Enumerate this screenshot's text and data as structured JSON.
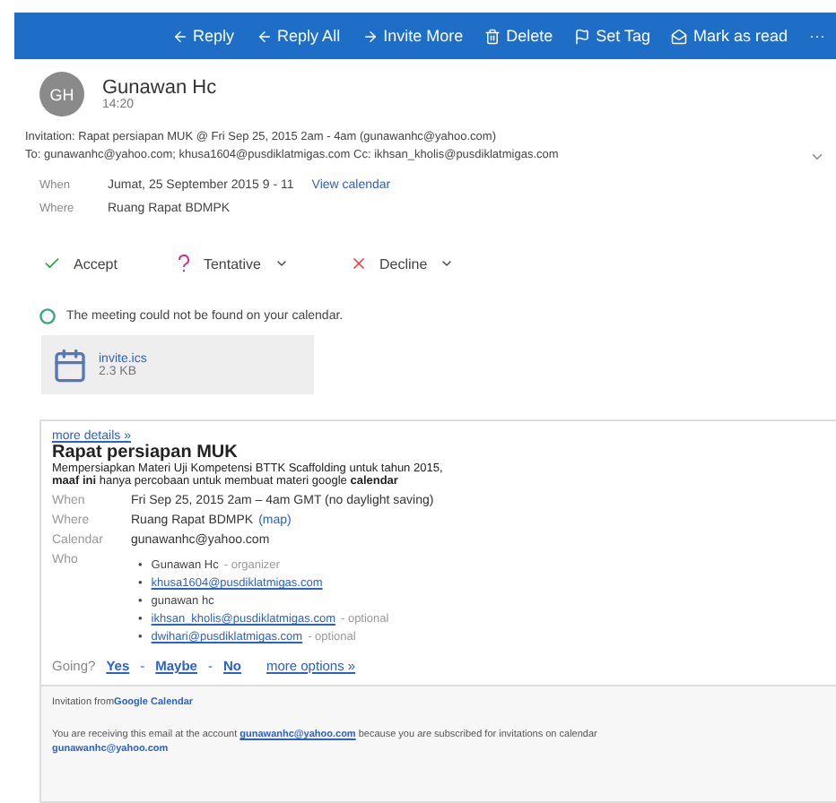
{
  "toolbar": {
    "actions": [
      {
        "kind": "reply",
        "label": "Reply"
      },
      {
        "kind": "reply-all",
        "label": "Reply All"
      },
      {
        "kind": "invite",
        "label": "Invite More"
      },
      {
        "kind": "delete",
        "label": "Delete"
      },
      {
        "kind": "flag",
        "label": "Set Tag"
      },
      {
        "kind": "read",
        "label": "Mark as read"
      }
    ],
    "more": "···"
  },
  "sender": {
    "initials": "GH",
    "name": "Gunawan Hc",
    "time": "14:20"
  },
  "subject": "Invitation: Rapat persiapan MUK @ Fri Sep 25, 2015 2am - 4am (gunawanhc@yahoo.com)",
  "recipients": "To: gunawanhc@yahoo.com; khusa1604@pusdiklatmigas.com  Cc: ikhsan_kholis@pusdiklatmigas.com",
  "meeting": {
    "when_label": "When",
    "when": "Jumat, 25 September 2015 9 - 11",
    "view_calendar": "View calendar",
    "where_label": "Where",
    "where": "Ruang Rapat BDMPK"
  },
  "responses": [
    {
      "kind": "accept",
      "label": "Accept",
      "dropdown": false
    },
    {
      "kind": "tentative",
      "label": "Tentative",
      "dropdown": true
    },
    {
      "kind": "decline",
      "label": "Decline",
      "dropdown": true
    }
  ],
  "status": "The meeting could not be found on your calendar.",
  "attachment": {
    "name": "invite.ics",
    "size": "2.3 KB"
  },
  "body": {
    "more_details": "more details »",
    "title": "Rapat persiapan MUK",
    "description": [
      "Mempersiapkan Materi Uji Kompetensi BTTK Scaffolding untuk tahun 2015,",
      "**maaf ini** hanya percobaan untuk membuat materi google **calendar**"
    ],
    "details": [
      {
        "label": "When",
        "value": "Fri Sep 25, 2015 2am – 4am GMT (no daylight saving)"
      },
      {
        "label": "Where",
        "value": "Ruang Rapat BDMPK",
        "link": "(map)"
      },
      {
        "label": "Calendar",
        "value": "gunawanhc@yahoo.com"
      }
    ],
    "who_label": "Who",
    "who": [
      {
        "name": "Gunawan Hc",
        "note": "- organizer",
        "link": false
      },
      {
        "name": "khusa1604@pusdiklatmigas.com",
        "link": true
      },
      {
        "name": "gunawan hc",
        "link": false
      },
      {
        "name": "ikhsan_kholis@pusdiklatmigas.com",
        "note": "- optional",
        "link": true
      },
      {
        "name": "dwihari@pusdiklatmigas.com",
        "note": "- optional",
        "link": true
      }
    ],
    "bullet": "•",
    "going_separator": "-",
    "going_label": "Going?",
    "going": [
      "Yes",
      "Maybe",
      "No"
    ],
    "more_options": "more options »"
  },
  "footer": {
    "invitation": "Invitation from ",
    "calendar_link": "Google Calendar",
    "notice": "You are receiving this email at the account ",
    "account_link": "gunawanhc@yahoo.com",
    "notice_end": " because you are subscribed for invitations on calendar",
    "calendar_account": "gunawanhc@yahoo.com"
  }
}
